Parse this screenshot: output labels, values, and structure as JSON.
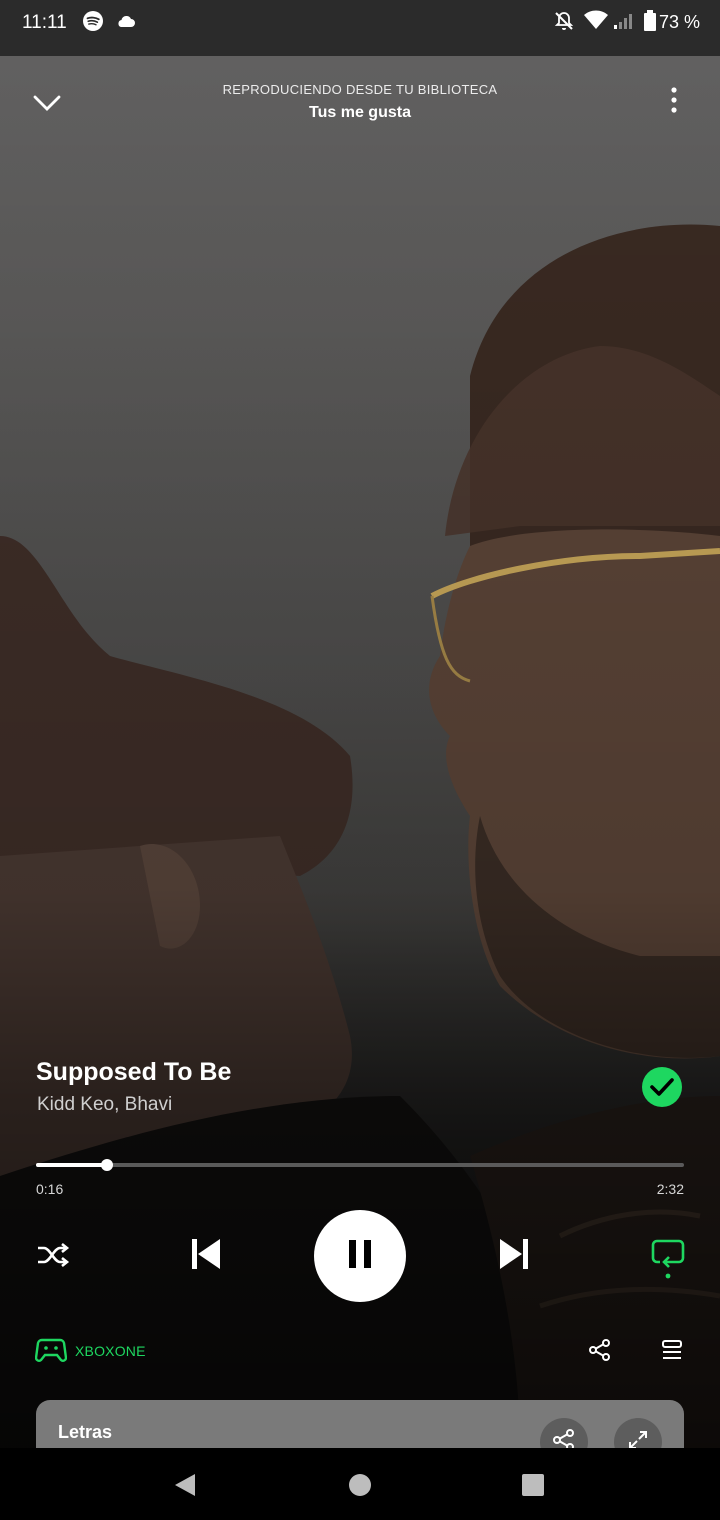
{
  "status_bar": {
    "time": "11:11",
    "battery": "73 %",
    "icons": [
      "spotify-icon",
      "cloud-icon",
      "bell-off-icon",
      "wifi-icon",
      "signal-icon",
      "battery-icon"
    ]
  },
  "header": {
    "context_label": "REPRODUCIENDO DESDE TU BIBLIOTECA",
    "context_name": "Tus me gusta"
  },
  "track": {
    "title": "Supposed To Be",
    "artists": "Kidd Keo, Bhavi",
    "liked": true
  },
  "progress": {
    "elapsed": "0:16",
    "duration": "2:32",
    "fraction": 0.11
  },
  "controls": {
    "shuffle": false,
    "repeat": true,
    "playing": true
  },
  "device": {
    "name": "XBOXONE"
  },
  "lyrics": {
    "title": "Letras"
  },
  "colors": {
    "accent": "#1ed760",
    "background": "#000000"
  }
}
